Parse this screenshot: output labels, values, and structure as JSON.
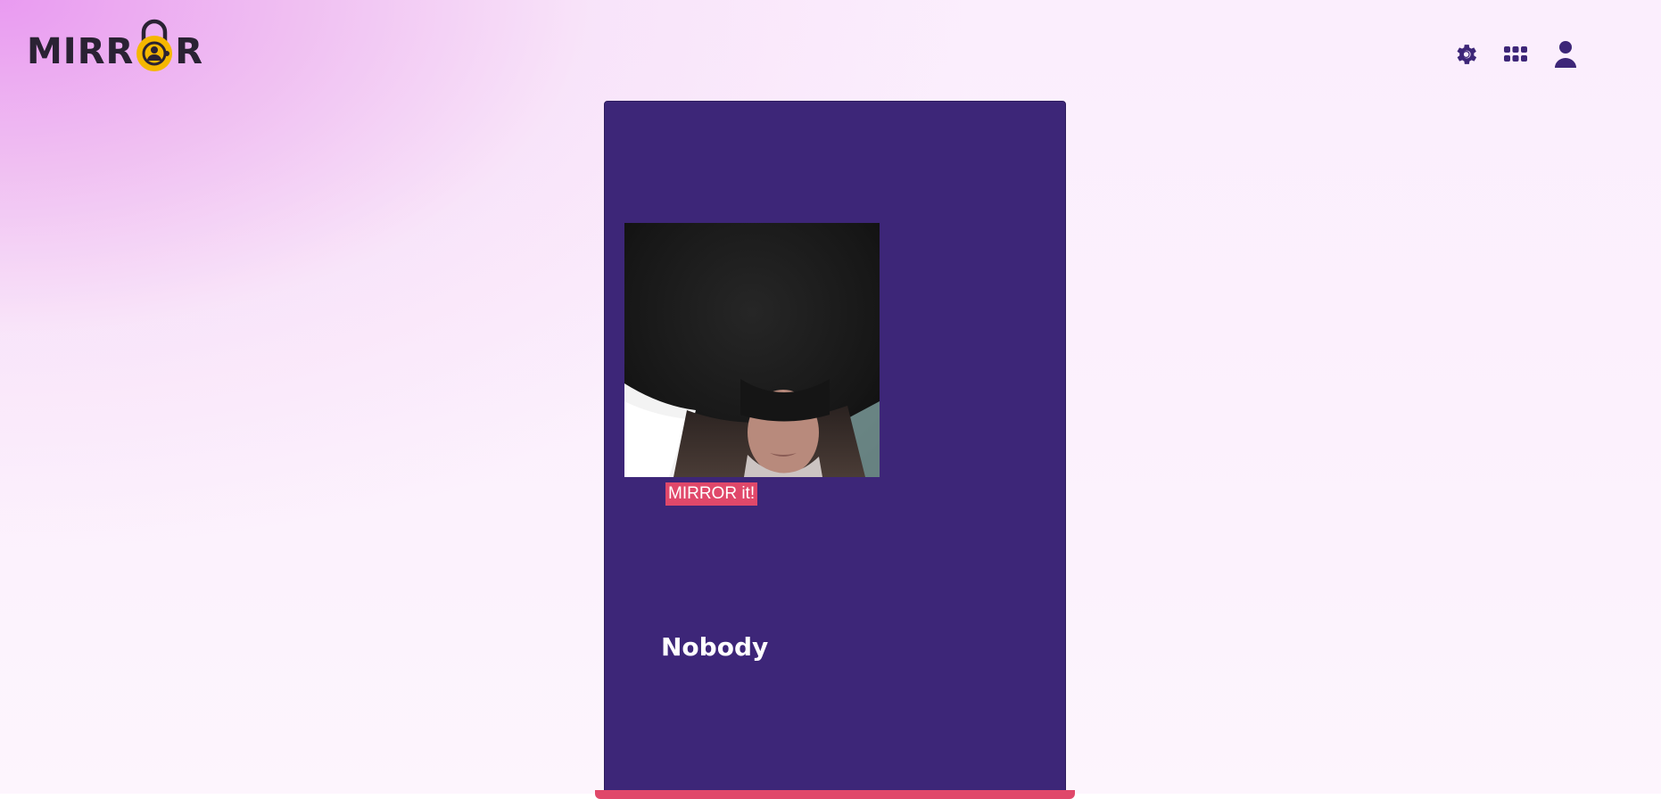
{
  "app": {
    "logo_text_left": "MIRR",
    "logo_text_right": "R",
    "logo_icon": "padlock-face-icon",
    "brand_colors": {
      "text": "#2a2233",
      "lock": "#f5b700",
      "accent": "#e0486a",
      "card": "#3d2678"
    }
  },
  "header": {
    "icons": [
      {
        "name": "gear-icon",
        "color": "#3d2678"
      },
      {
        "name": "apps-grid-icon",
        "color": "#3d2678"
      },
      {
        "name": "user-icon",
        "color": "#3d2678"
      }
    ]
  },
  "card": {
    "photo": "webcam-capture",
    "button_label": "MIRROR it!",
    "result_text": "Nobody"
  }
}
